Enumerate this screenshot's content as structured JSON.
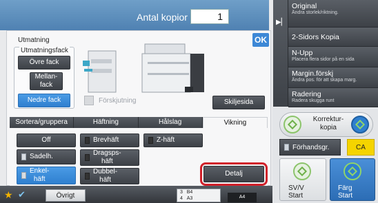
{
  "header": {
    "copies_label": "Antal kopior",
    "copies_value": "1"
  },
  "panel": {
    "title": "Utmatning",
    "ok_label": "OK",
    "tray_group_label": "Utmatningsfack",
    "trays": [
      "Övre fack",
      "Mellan-\nfack",
      "Nedre fack"
    ],
    "shift_label": "Förskjutning",
    "separator_label": "Skiljesida",
    "tabs": [
      "Sortera/gruppera",
      "Häftning",
      "Hålslag",
      "Vikning"
    ],
    "fold_options": {
      "off": "Off",
      "saddle": "Sadelh.",
      "single": "Enkel-\nhäft",
      "brevhaft": "Brevhäft",
      "dragspel": "Dragsps-\nhäft",
      "dubbel": "Dubbel-\nhäft",
      "z": "Z-häft"
    },
    "detail_label": "Detalj"
  },
  "menu": [
    {
      "main": "Original",
      "sub": "Ändra storlek/riktning."
    },
    {
      "main": "2-Sidors Kopia",
      "sub": ""
    },
    {
      "main": "N-Upp",
      "sub": "Placera flera sidor på en sida"
    },
    {
      "main": "Margin.förskj",
      "sub": "Ändra pos. för att skapa marg."
    },
    {
      "main": "Radering",
      "sub": "Radera skugga runt"
    }
  ],
  "right": {
    "proof_label": "Korrektur-\nkopia",
    "preview_label": "Förhandsgr.",
    "ca_label": "CA",
    "start_bw": "SV/V\nStart",
    "start_color": "Färg\nStart"
  },
  "bottom": {
    "other_label": "Övrigt",
    "tray_rows": [
      {
        "num": "3",
        "size": "B4"
      },
      {
        "num": "4",
        "size": "A3"
      }
    ],
    "paper_label": "A4"
  },
  "colors": {
    "accent": "#3d88d6",
    "focus": "#d0202a",
    "ca": "#f5d400",
    "start_color": "#2c6db5"
  }
}
